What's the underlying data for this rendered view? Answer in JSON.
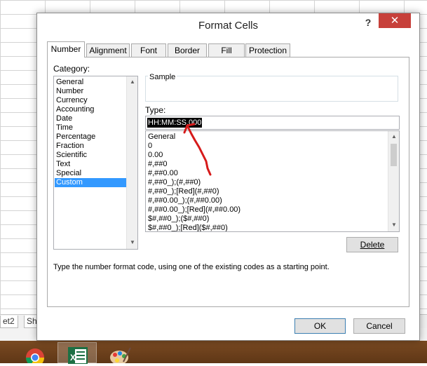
{
  "sheet": {
    "tabs": [
      "et2",
      "Sh"
    ]
  },
  "dialog": {
    "title": "Format Cells",
    "help_label": "?",
    "close_label": "✕",
    "tabs": [
      "Number",
      "Alignment",
      "Font",
      "Border",
      "Fill",
      "Protection"
    ],
    "selected_tab": "Number",
    "category_label": "Category:",
    "categories": [
      "General",
      "Number",
      "Currency",
      "Accounting",
      "Date",
      "Time",
      "Percentage",
      "Fraction",
      "Scientific",
      "Text",
      "Special",
      "Custom"
    ],
    "selected_category": "Custom",
    "sample_label": "Sample",
    "type_label": "Type:",
    "type_value": "HH:MM:SS.000",
    "formats": [
      "General",
      "0",
      "0.00",
      "#,##0",
      "#,##0.00",
      "#,##0_);(#,##0)",
      "#,##0_);[Red](#,##0)",
      "#,##0.00_);(#,##0.00)",
      "#,##0.00_);[Red](#,##0.00)",
      "$#,##0_);($#,##0)",
      "$#,##0_);[Red]($#,##0)"
    ],
    "delete_label": "Delete",
    "hint": "Type the number format code, using one of the existing codes as a starting point.",
    "ok_label": "OK",
    "cancel_label": "Cancel"
  },
  "annotation": {
    "color": "#d61a1a"
  },
  "taskbar": {
    "apps": [
      "chrome-icon",
      "excel-icon",
      "paint-icon"
    ]
  }
}
